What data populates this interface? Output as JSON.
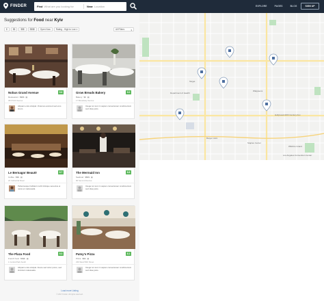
{
  "header": {
    "brand": "FINDER",
    "search_what_label": "Find",
    "search_what_placeholder": "What are you looking for",
    "search_where_label": "Near",
    "search_where_placeholder": "Location",
    "nav": [
      "EXPLORE",
      "PAGES",
      "BLOG"
    ],
    "signup": "SIGN UP"
  },
  "listing": {
    "suggest_prefix": "Suggestions for",
    "suggest_term": "Food",
    "suggest_mid": "near",
    "suggest_place": "Kyiv",
    "filters": [
      "$",
      "$$",
      "$$$",
      "$$$$",
      "Open Now",
      "Rating - High to Low"
    ],
    "all_filters": "All Filters",
    "cards": [
      {
        "title": "Nobus Grand Avenue",
        "score": "9.6",
        "category": "Restaurant",
        "price": "$$$$",
        "address": "364 Park Avenue",
        "review": "Aliquam erat volutpat. Vivamus euismod sed eros lorem."
      },
      {
        "title": "Grow Breads Bakery",
        "score": "9.0",
        "category": "Bakery",
        "price": "$$",
        "address": "17 Broadway Avenue",
        "review": "Integer at nunc in sapien consectetuer condimentum sed vitae justo."
      },
      {
        "title": "Le Bernagor Beauté",
        "score": "8.7",
        "category": "Coffee",
        "price": "$$$",
        "address": "24 Cathedral Road",
        "review": "Pellentesque habitant morbi tristique senectus et netus et malesuada."
      },
      {
        "title": "The Mermaid Inn",
        "score": "8.8",
        "category": "Seafood",
        "price": "$$$$",
        "address": "96 Second Avenue",
        "review": "Integer at nunc in sapien consectetuer condimentum sed vitae justo."
      },
      {
        "title": "The Plaza Food",
        "score": "9.3",
        "category": "French food",
        "price": "$$$$",
        "address": "1 Central Park South",
        "review": "Aliquam erat volutpat. Fusce sed tortor purus, sed tincidunt malesuada."
      },
      {
        "title": "Patsy's Pizza",
        "score": "8.1",
        "category": "Pizza",
        "price": "$$$",
        "address": "236 West 56th Street",
        "review": "Integer at nunc in sapien consectetuer condimentum sed vitae justo."
      }
    ],
    "load_more": "Load more Listing",
    "copyright": "© 2017 Finder. All rights reserved."
  },
  "map": {
    "labels": [
      "Target",
      "Department of Health",
      "Walgreens",
      "Hollywood 20th Century Fox",
      "Burger Joint",
      "Los Angeles Convention Center",
      "Staples Center",
      "Wilshire Grand"
    ]
  }
}
